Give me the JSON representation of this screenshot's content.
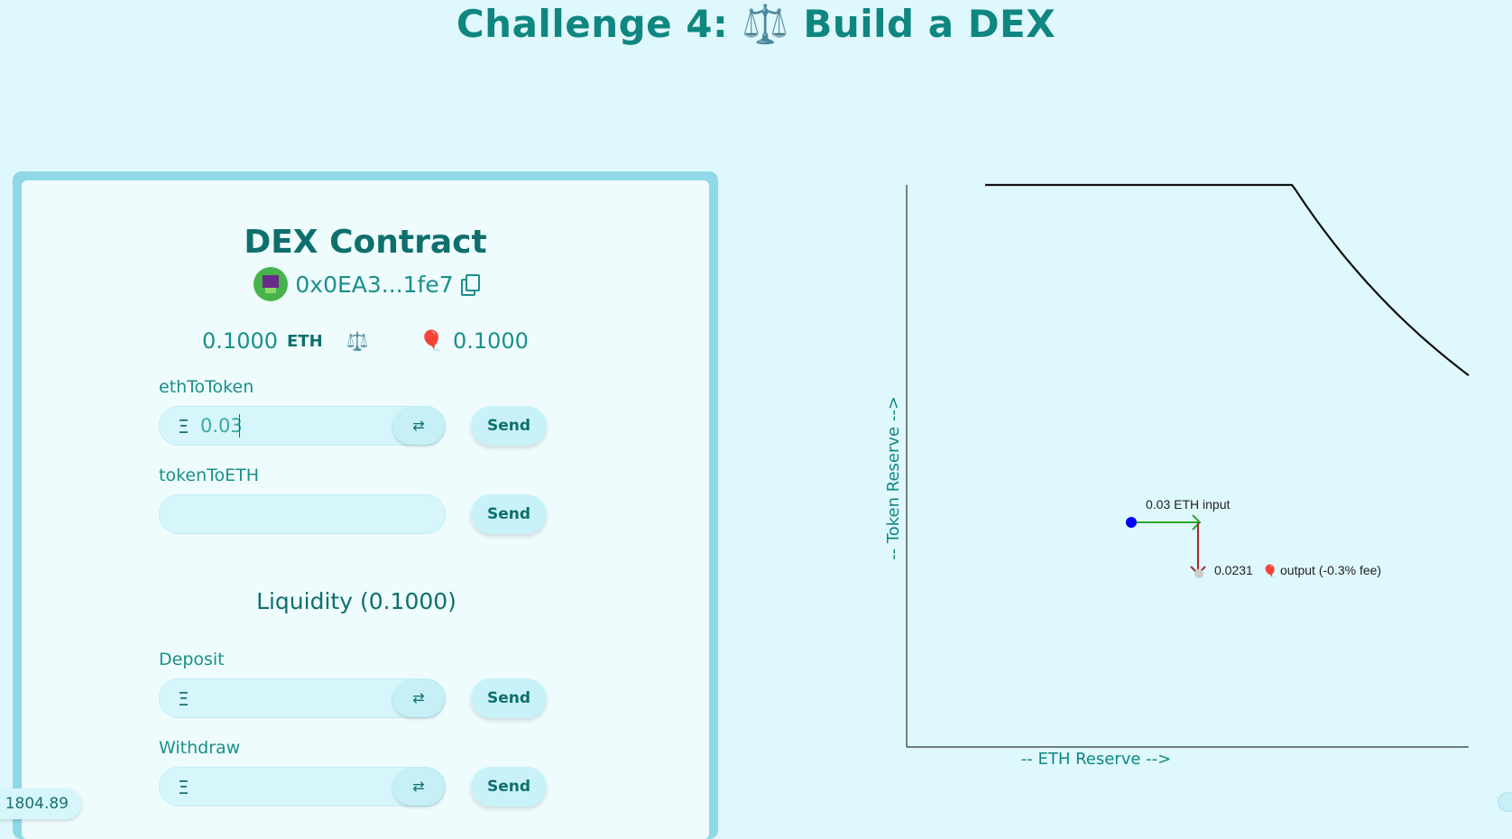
{
  "header": {
    "title": "Challenge 4: ⚖️ Build a DEX"
  },
  "dex": {
    "title": "DEX Contract",
    "address": "0x0EA3...1fe7",
    "eth_balance": "0.1000",
    "eth_unit": "ETH",
    "scale_icon": "⚖️",
    "balloon_icon": "🎈",
    "token_balance": "0.1000",
    "ethToToken": {
      "label": "ethToToken",
      "prefix": "Ξ",
      "value": "0.03",
      "send": "Send",
      "swap_icon": "⇄"
    },
    "tokenToETH": {
      "label": "tokenToETH",
      "value": "",
      "send": "Send"
    },
    "liquidity_title": "Liquidity (0.1000)",
    "deposit": {
      "label": "Deposit",
      "prefix": "Ξ",
      "value": "",
      "send": "Send",
      "swap_icon": "⇄"
    },
    "withdraw": {
      "label": "Withdraw",
      "prefix": "Ξ",
      "value": "",
      "send": "Send",
      "swap_icon": "⇄"
    }
  },
  "price": {
    "value": "1804.89"
  },
  "chart_data": {
    "type": "line",
    "title": "",
    "xlabel": "-- ETH Reserve -->",
    "ylabel": "-- Token Reserve -->",
    "curve": "x*y=k",
    "annotations": [
      {
        "text": "0.03 ETH input",
        "color": "green"
      },
      {
        "text": "0.0231",
        "icon": "🎈",
        "suffix": "output (-0.3% fee)",
        "color": "darkred"
      }
    ],
    "points": [
      {
        "name": "current-reserve",
        "color": "#0000ff"
      },
      {
        "name": "after-swap",
        "color": "#cccccc"
      }
    ],
    "grid": false
  },
  "colors": {
    "accent": "#0f8680",
    "background": "#dff8fd",
    "card_border": "#8fd8e6"
  }
}
